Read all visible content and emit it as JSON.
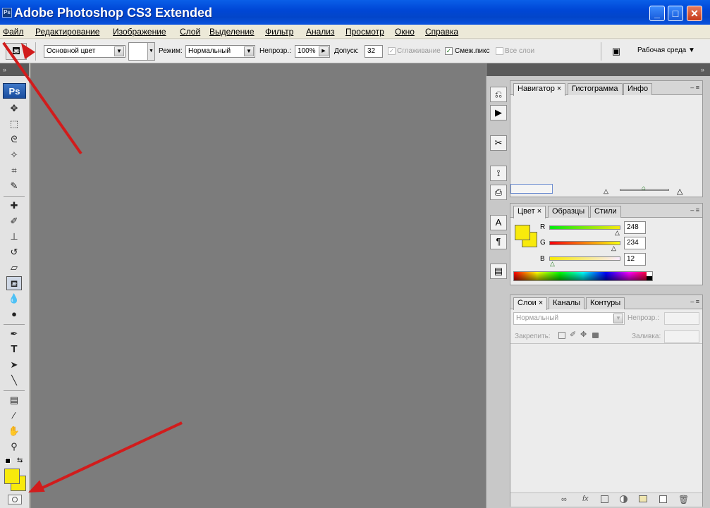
{
  "window": {
    "title": "Adobe Photoshop CS3 Extended",
    "app_icon_text": "Ps",
    "minimize": "_",
    "maximize": "□",
    "close": "✕"
  },
  "menu": [
    "Файл",
    "Редактирование",
    "Изображение",
    "Слой",
    "Выделение",
    "Фильтр",
    "Анализ",
    "Просмотр",
    "Окно",
    "Справка"
  ],
  "options": {
    "fill_source": "Основной цвет",
    "mode_label": "Режим:",
    "mode_value": "Нормальный",
    "opacity_label": "Непрозр.:",
    "opacity_value": "100%",
    "tolerance_label": "Допуск:",
    "tolerance_value": "32",
    "antialias_label": "Сглаживание",
    "contiguous_label": "Смеж.пикс",
    "all_layers_label": "Все слои",
    "workspace_label": "Рабочая среда",
    "workspace_arrow": "▼"
  },
  "toolbox": {
    "logo": "Ps",
    "grip": "»"
  },
  "navigator_panel": {
    "tabs": [
      "Навигатор",
      "Гистограмма",
      "Инфо"
    ]
  },
  "color_panel": {
    "tabs": [
      "Цвет",
      "Образцы",
      "Стили"
    ],
    "channels": [
      {
        "label": "R",
        "value": "248"
      },
      {
        "label": "G",
        "value": "234"
      },
      {
        "label": "B",
        "value": "12"
      }
    ],
    "foreground": "#f8ea0c",
    "background": "#f8ea0c"
  },
  "layers_panel": {
    "tabs": [
      "Слои",
      "Каналы",
      "Контуры"
    ],
    "blend_mode": "Нормальный",
    "opacity_label": "Непрозр.:",
    "lock_label": "Закрепить:",
    "fill_label": "Заливка:",
    "footer_icons": [
      "link-icon",
      "fx-icon",
      "mask-icon",
      "adjustment-icon",
      "group-icon",
      "new-layer-icon",
      "trash-icon"
    ]
  },
  "annotations": {
    "arrow_color": "#d11c1c"
  }
}
